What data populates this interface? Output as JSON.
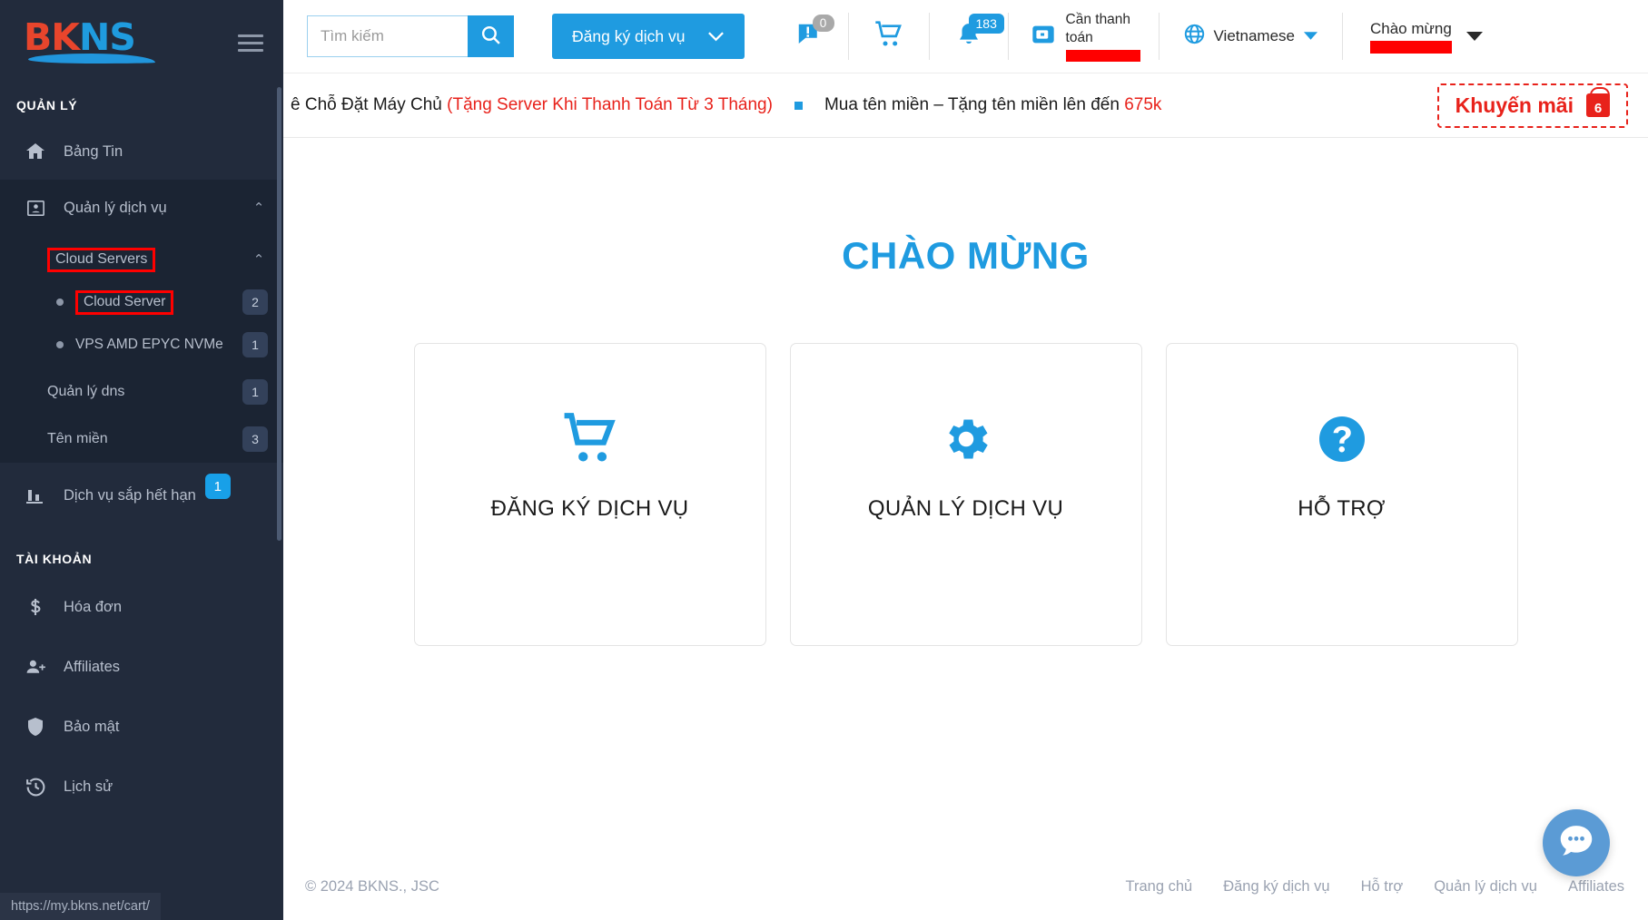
{
  "sidebar": {
    "logo": {
      "part1": "BK",
      "part2": "NS"
    },
    "section_manage": "QUẢN LÝ",
    "section_account": "TÀI KHOẢN",
    "dashboard": {
      "label": "Bảng Tin",
      "icon": "home-icon"
    },
    "service_group": {
      "label": "Quản lý dịch vụ",
      "icon": "id-card-icon",
      "caret": "⌃"
    },
    "cloud_servers": {
      "label": "Cloud Servers",
      "caret": "⌃"
    },
    "cloud_server": {
      "label": "Cloud Server",
      "badge": "2"
    },
    "vps": {
      "label": "VPS AMD EPYC NVMe",
      "badge": "1"
    },
    "dns": {
      "label": "Quản lý dns",
      "badge": "1"
    },
    "domain": {
      "label": "Tên miền",
      "badge": "3"
    },
    "expiring": {
      "label": "Dịch vụ sắp hết hạn",
      "badge": "1",
      "icon": "chart-bars-icon"
    },
    "invoice": {
      "label": "Hóa đơn",
      "icon": "dollar-icon"
    },
    "affiliates": {
      "label": "Affiliates",
      "icon": "user-plus-icon"
    },
    "security": {
      "label": "Bảo mật",
      "icon": "shield-icon"
    },
    "history": {
      "label": "Lịch sử",
      "icon": "history-clock-icon"
    },
    "status_url": "https://my.bkns.net/cart/"
  },
  "header": {
    "search_placeholder": "Tìm kiếm",
    "search_value": "",
    "search_icon": "search-icon",
    "register_button": "Đăng ký dịch vụ",
    "register_caret": "⌄",
    "ticket_icon": "ticket-alert-icon",
    "ticket_count": "0",
    "cart_icon": "cart-icon",
    "bell_icon": "bell-icon",
    "bell_count": "183",
    "wallet_icon": "wallet-icon",
    "payment_label": "Cần thanh toán",
    "payment_amount_redacted": true,
    "globe_icon": "globe-icon",
    "language": "Vietnamese",
    "greeting": "Chào mừng",
    "greeting_name_redacted": true
  },
  "promo": {
    "item1_black": "ê Chỗ Đặt Máy Chủ ",
    "item1_red": "(Tặng Server Khi Thanh Toán Từ 3 Tháng)",
    "item2_black": "Mua tên miền – Tặng tên miền lên đến ",
    "item2_red": "675k",
    "button_label": "Khuyến mãi",
    "gift_count": "6",
    "gift_icon": "gift-icon"
  },
  "content": {
    "welcome_title": "CHÀO MỪNG",
    "cards": [
      {
        "title": "ĐĂNG KÝ DỊCH VỤ",
        "icon": "cart-icon"
      },
      {
        "title": "QUẢN LÝ DỊCH VỤ",
        "icon": "gear-icon"
      },
      {
        "title": "HỖ TRỢ",
        "icon": "question-circle-icon"
      }
    ]
  },
  "footer": {
    "copyright": "© 2024 BKNS., JSC",
    "links": [
      "Trang chủ",
      "Đăng ký dịch vụ",
      "Hỗ trợ",
      "Quản lý dịch vụ",
      "Affiliates"
    ]
  },
  "chat": {
    "icon": "chat-dots-icon"
  },
  "colors": {
    "brand_blue": "#1f9be0",
    "sidebar_bg": "#222b3c",
    "accent_red": "#e8221b",
    "highlight_red": "#ff0000"
  }
}
